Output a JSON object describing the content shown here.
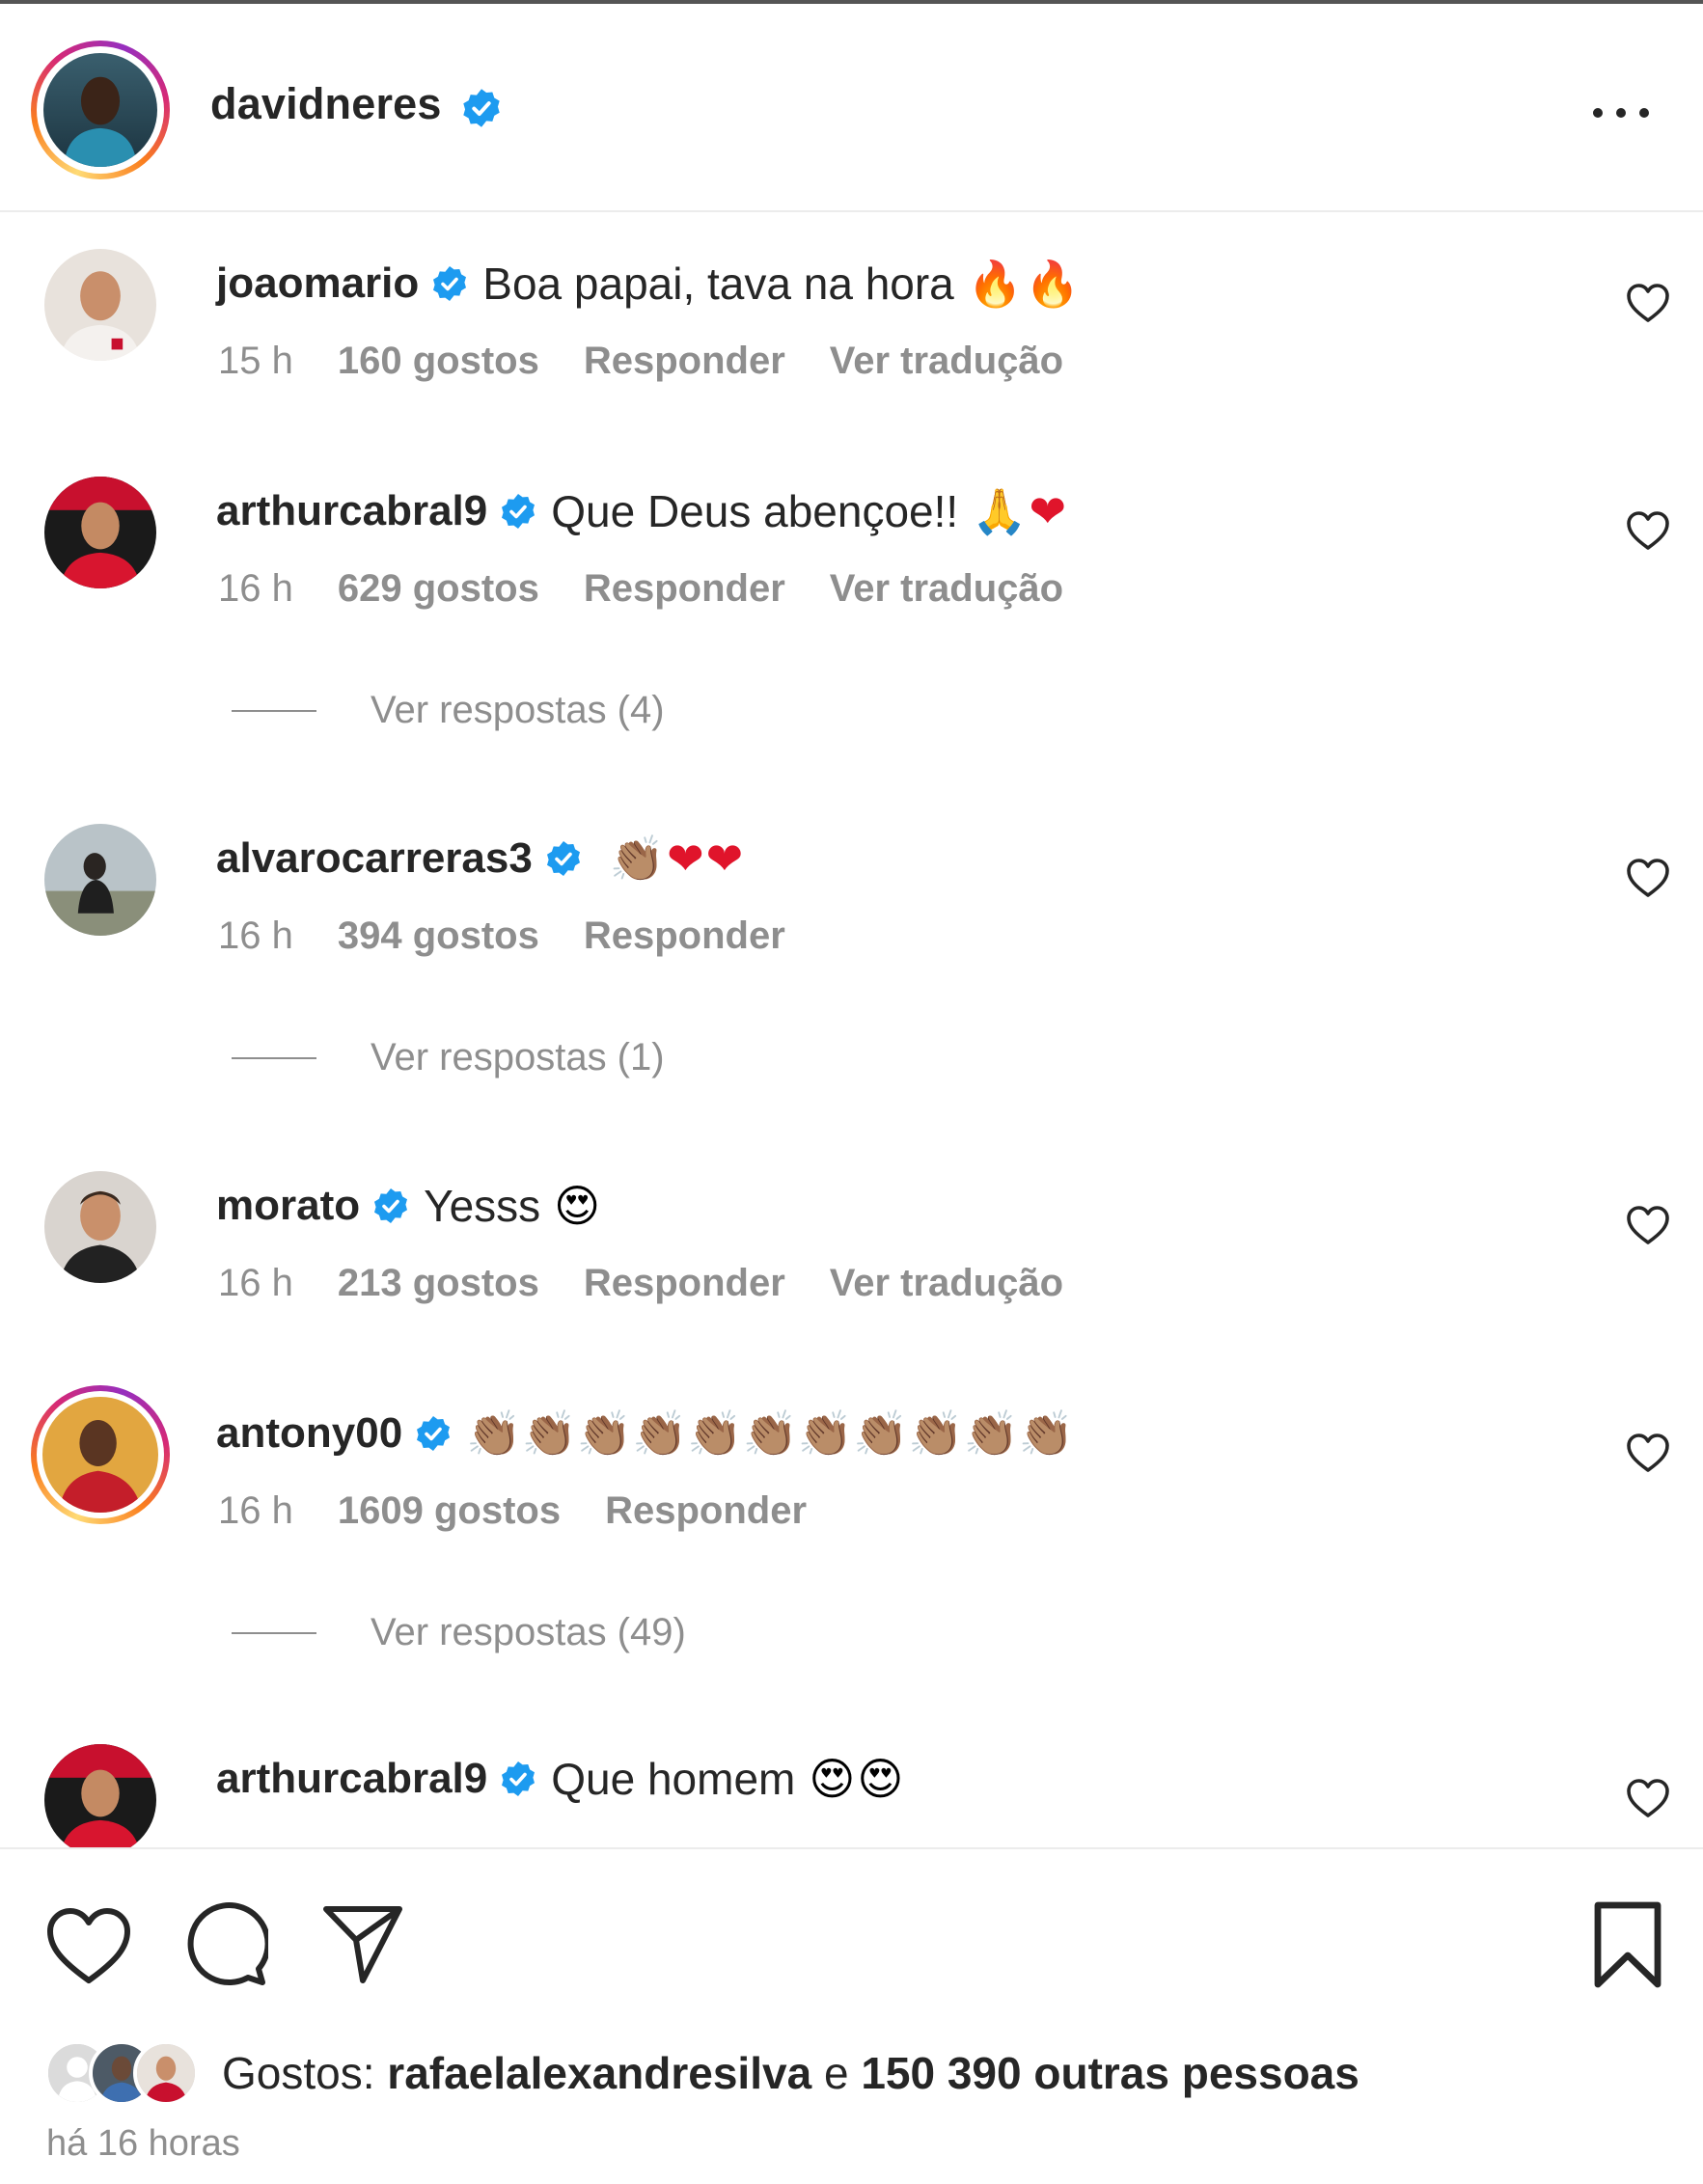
{
  "post": {
    "author": "davidneres",
    "verified": true,
    "more_icon": "more-horizontal-icon"
  },
  "comments": [
    {
      "user": "joaomario",
      "verified": true,
      "text": "Boa papai, tava na hora",
      "emoji": "🔥🔥",
      "time": "15 h",
      "likes": "160 gostos",
      "reply": "Responder",
      "translate": "Ver tradução",
      "replies": ""
    },
    {
      "user": "arthurcabral9",
      "verified": true,
      "text": "Que Deus abençoe!!",
      "emoji": "🙏❤",
      "time": "16 h",
      "likes": "629 gostos",
      "reply": "Responder",
      "translate": "Ver tradução",
      "replies": "Ver respostas (4)"
    },
    {
      "user": "alvarocarreras3",
      "verified": true,
      "text": "",
      "emoji": "👏🏽❤❤",
      "time": "16 h",
      "likes": "394 gostos",
      "reply": "Responder",
      "translate": "",
      "replies": "Ver respostas (1)"
    },
    {
      "user": "morato",
      "verified": true,
      "text": "Yesss",
      "emoji": "😍",
      "time": "16 h",
      "likes": "213 gostos",
      "reply": "Responder",
      "translate": "Ver tradução",
      "replies": ""
    },
    {
      "user": "antony00",
      "verified": true,
      "text": "",
      "emoji": "👏🏽👏🏽👏🏽👏🏽👏🏽👏🏽👏🏽👏🏽👏🏽👏🏽👏🏽",
      "time": "16 h",
      "likes": "1609 gostos",
      "reply": "Responder",
      "translate": "",
      "replies": "Ver respostas (49)"
    },
    {
      "user": "arthurcabral9",
      "verified": true,
      "text": "Que homem",
      "emoji": "😍😍",
      "time": "",
      "likes": "",
      "reply": "",
      "translate": "",
      "replies": ""
    }
  ],
  "footer": {
    "likes_prefix": "Gostos:",
    "likes_user": "rafaelalexandresilva",
    "likes_join": "e",
    "likes_others": "150 390 outras pessoas",
    "time_ago": "há 16 horas",
    "icons": [
      "heart-icon",
      "comment-icon",
      "share-icon",
      "bookmark-icon"
    ]
  },
  "colors": {
    "verified": "#1d9bf0",
    "muted": "#8e8e8e",
    "text": "#262626"
  }
}
